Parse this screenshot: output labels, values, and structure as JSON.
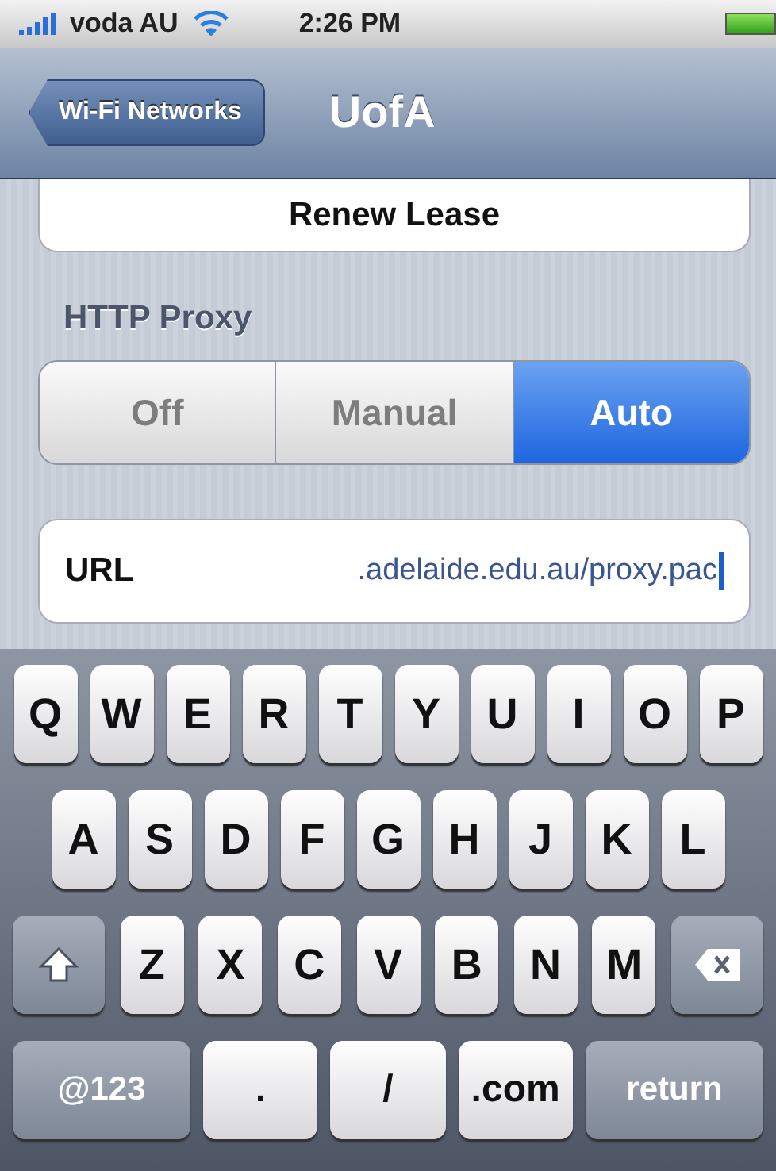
{
  "status_bar": {
    "carrier": "voda AU",
    "time": "2:26 PM"
  },
  "nav": {
    "back": "Wi-Fi Networks",
    "title": "UofA"
  },
  "renew_button": "Renew Lease",
  "section_title": "HTTP Proxy",
  "proxy_modes": [
    {
      "label": "Off",
      "selected": false
    },
    {
      "label": "Manual",
      "selected": false
    },
    {
      "label": "Auto",
      "selected": true
    }
  ],
  "url_field": {
    "label": "URL",
    "value": ".adelaide.edu.au/proxy.pac"
  },
  "keyboard": {
    "key_rows": [
      {
        "keys": [
          {
            "kind": "letter",
            "label": "Q"
          },
          {
            "kind": "letter",
            "label": "W"
          },
          {
            "kind": "letter",
            "label": "E"
          },
          {
            "kind": "letter",
            "label": "R"
          },
          {
            "kind": "letter",
            "label": "T"
          },
          {
            "kind": "letter",
            "label": "Y"
          },
          {
            "kind": "letter",
            "label": "U"
          },
          {
            "kind": "letter",
            "label": "I"
          },
          {
            "kind": "letter",
            "label": "O"
          },
          {
            "kind": "letter",
            "label": "P"
          }
        ]
      },
      {
        "keys": [
          {
            "kind": "letter",
            "label": "A"
          },
          {
            "kind": "letter",
            "label": "S"
          },
          {
            "kind": "letter",
            "label": "D"
          },
          {
            "kind": "letter",
            "label": "F"
          },
          {
            "kind": "letter",
            "label": "G"
          },
          {
            "kind": "letter",
            "label": "H"
          },
          {
            "kind": "letter",
            "label": "J"
          },
          {
            "kind": "letter",
            "label": "K"
          },
          {
            "kind": "letter",
            "label": "L"
          }
        ]
      },
      {
        "keys": [
          {
            "kind": "shift"
          },
          {
            "kind": "letter",
            "label": "Z"
          },
          {
            "kind": "letter",
            "label": "X"
          },
          {
            "kind": "letter",
            "label": "C"
          },
          {
            "kind": "letter",
            "label": "V"
          },
          {
            "kind": "letter",
            "label": "B"
          },
          {
            "kind": "letter",
            "label": "N"
          },
          {
            "kind": "letter",
            "label": "M"
          },
          {
            "kind": "delete"
          }
        ]
      },
      {
        "keys": [
          {
            "kind": "mode",
            "label": "@123"
          },
          {
            "kind": "letter",
            "label": "."
          },
          {
            "kind": "letter",
            "label": "/"
          },
          {
            "kind": "letter",
            "label": ".com"
          },
          {
            "kind": "mode",
            "label": "return"
          }
        ]
      }
    ]
  }
}
